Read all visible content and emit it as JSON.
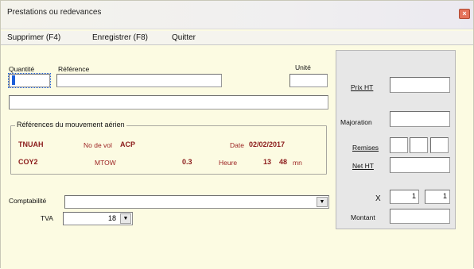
{
  "window": {
    "title": "Prestations ou redevances",
    "close_glyph": "×"
  },
  "menu": {
    "items": [
      "Supprimer (F4)",
      "Enregistrer (F8)",
      "Quitter"
    ]
  },
  "form": {
    "quantite_label": "Quantité",
    "reference_label": "Référence",
    "unite_label": "Unité",
    "quantite_value": "",
    "reference_value": "",
    "unite_value": "",
    "description_value": ""
  },
  "mouvement": {
    "group_title": "Références du mouvement aérien",
    "registration": "TNUAH",
    "no_vol_label": "No de vol",
    "no_vol_value": "ACP",
    "date_label": "Date",
    "date_value": "02/02/2017",
    "aircraft_type": "COY2",
    "mtow_label": "MTOW",
    "mtow_value": "0.3",
    "heure_label": "Heure",
    "heure_h": "13",
    "heure_m": "48",
    "heure_unit": "mn"
  },
  "compta": {
    "comptabilite_label": "Comptabilité",
    "comptabilite_value": "",
    "tva_label": "TVA",
    "tva_value": "18"
  },
  "pricing": {
    "prix_ht_label": "Prix HT",
    "majoration_label": "Majoration",
    "remises_label": "Remises",
    "net_ht_label": "Net HT",
    "x_label": "X",
    "x_value_1": "1",
    "x_value_2": "1",
    "montant_label": "Montant"
  },
  "icons": {
    "dropdown": "▼"
  }
}
